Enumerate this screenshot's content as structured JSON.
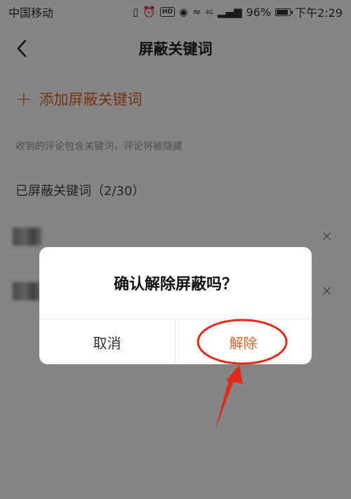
{
  "status_bar": {
    "carrier": "中国移动",
    "net_type": "4G",
    "battery_text": "96%",
    "battery_level": 0.96,
    "time": "下午2:29"
  },
  "header": {
    "title": "屏蔽关键词"
  },
  "add_keyword_label": "添加屏蔽关键词",
  "hint": "收到的评论包含关键词，评论将被隐藏",
  "blocked_heading": "已屏蔽关键词（2/30）",
  "keywords": [
    {
      "close": "×"
    },
    {
      "close": "×"
    }
  ],
  "dialog": {
    "message": "确认解除屏蔽吗？",
    "cancel_label": "取消",
    "confirm_label": "解除"
  },
  "colors": {
    "accent": "#e0622a",
    "annotation": "#e02a1a",
    "overlay": "rgba(0,0,0,0.48)"
  }
}
